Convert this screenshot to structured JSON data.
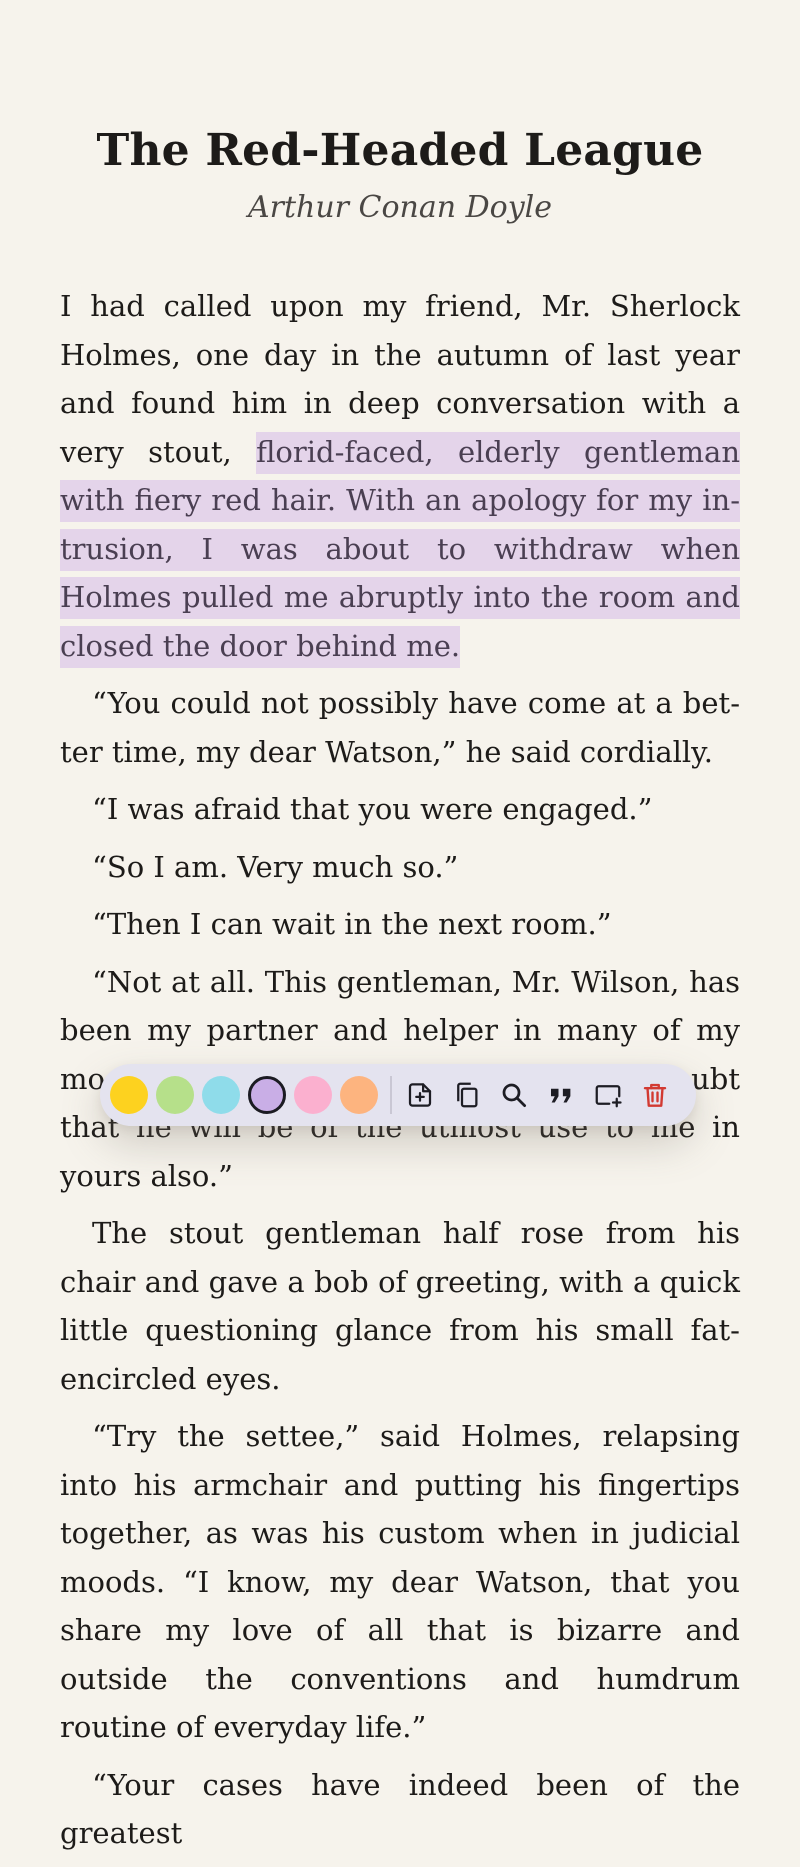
{
  "book": {
    "title": "The Red-Headed League",
    "author": "Arthur Conan Doyle"
  },
  "paragraphs": [
    {
      "before": "I had called upon my friend, Mr. Sherlock Holmes, one day in the autumn of last year and found him in deep conversation with a very stout, ",
      "highlight": "florid-faced, elderly gentleman with fiery red hair. With an apology for my in­trusion, I was about to withdraw when Holmes pulled me abruptly into the room and closed the door behind me."
    },
    {
      "text": "“You could not possibly have come at a bet­ter time, my dear Watson,” he said cordially."
    },
    {
      "text": "“I was afraid that you were engaged.”"
    },
    {
      "text": "“So I am. Very much so.”"
    },
    {
      "text": "“Then I can wait in the next room.”"
    },
    {
      "text": "“Not at all. This gentleman, Mr. Wilson, has been my partner and helper in many of my most successful cases, and I have no doubt that he will be of the utmost use to me in yours also.”"
    },
    {
      "text": "The stout gentleman half rose from his chair and gave a bob of greeting, with a quick little questioning glance from his small fat-encircled eyes."
    },
    {
      "text": "“Try the settee,” said Holmes, relapsing into his armchair and putting his fingertips to­gether, as was his custom when in judicial moods. “I know, my dear Watson, that you share my love of all that is bizarre and outside the conventions and humdrum routine of ev­eryday life.”"
    },
    {
      "text": "“Your cases have indeed been of the greatest"
    }
  ],
  "toolbar": {
    "colors": [
      {
        "name": "yellow",
        "hex": "#fdd21f"
      },
      {
        "name": "green",
        "hex": "#b6e08a"
      },
      {
        "name": "blue",
        "hex": "#8fdcea"
      },
      {
        "name": "purple",
        "hex": "#c9aee6",
        "selected": true
      },
      {
        "name": "pink",
        "hex": "#fbb0cf"
      },
      {
        "name": "orange",
        "hex": "#fdb47f"
      }
    ],
    "actions": [
      {
        "name": "add-note",
        "icon": "note-add-icon"
      },
      {
        "name": "copy",
        "icon": "copy-icon"
      },
      {
        "name": "search",
        "icon": "search-icon"
      },
      {
        "name": "quote",
        "icon": "quote-icon"
      },
      {
        "name": "add-bookmark",
        "icon": "add-frame-icon"
      },
      {
        "name": "delete",
        "icon": "trash-icon",
        "color": "#d23a32"
      }
    ]
  }
}
